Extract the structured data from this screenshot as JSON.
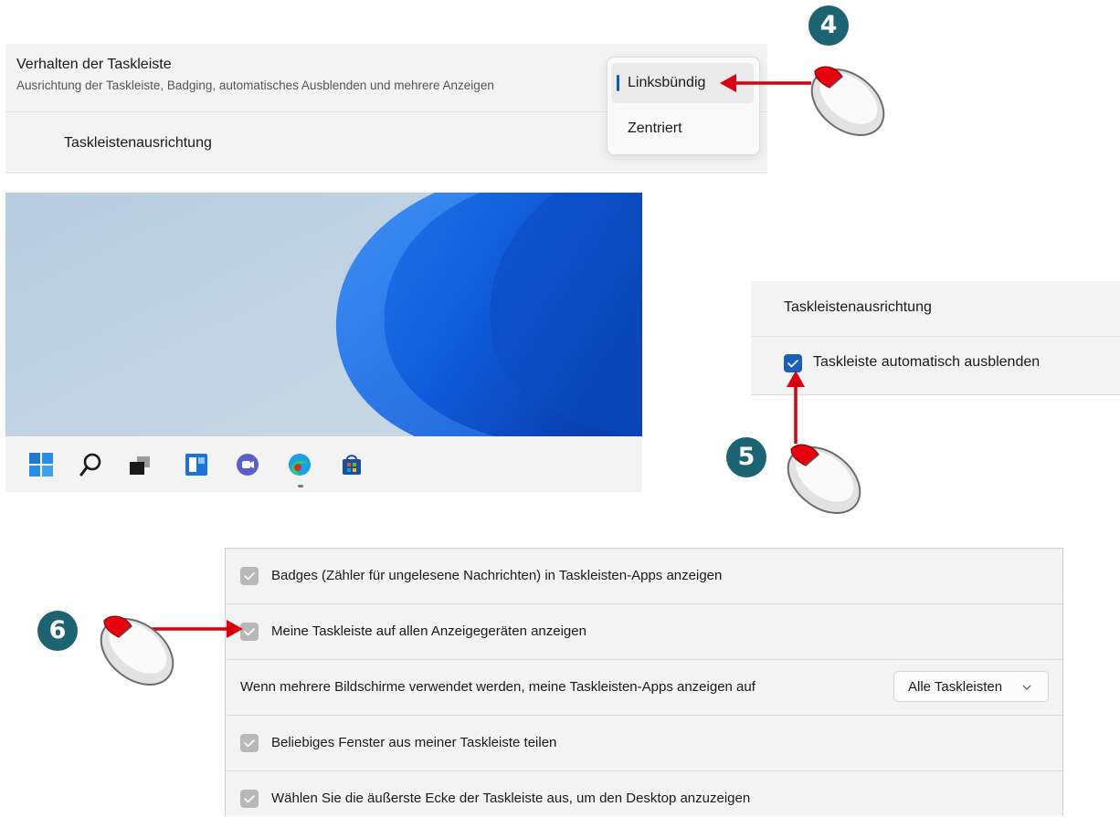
{
  "taskbar_settings": {
    "title": "Verhalten der Taskleiste",
    "subtitle": "Ausrichtung der Taskleiste, Badging, automatisches Ausblenden und mehrere Anzeigen",
    "alignment_label": "Taskleistenausrichtung"
  },
  "alignment_flyout": {
    "options": [
      {
        "label": "Linksbündig",
        "selected": true
      },
      {
        "label": "Zentriert",
        "selected": false
      }
    ]
  },
  "taskbar_icons": [
    "windows-start-icon",
    "search-icon",
    "task-view-icon",
    "widgets-icon",
    "chat-icon",
    "edge-icon",
    "store-icon"
  ],
  "autohide_panel": {
    "alignment_label": "Taskleistenausrichtung",
    "autohide_label": "Taskleiste automatisch ausblenden",
    "autohide_checked": true
  },
  "multi_display_panel": {
    "rows": [
      {
        "label": "Badges (Zähler für ungelesene Nachrichten) in Taskleisten-Apps anzeigen",
        "checked": true
      },
      {
        "label": "Meine Taskleiste auf allen Anzeigegeräten anzeigen",
        "checked": true
      },
      {
        "label": "Wenn mehrere Bildschirme verwendet werden, meine Taskleisten-Apps anzeigen auf",
        "dropdown_value": "Alle Taskleisten"
      },
      {
        "label": "Beliebiges Fenster aus meiner Taskleiste teilen",
        "checked": true
      },
      {
        "label": "Wählen Sie die äußerste Ecke der Taskleiste aus, um den Desktop anzuzeigen",
        "checked": true
      }
    ]
  },
  "callouts": [
    "4",
    "5",
    "6"
  ],
  "colors": {
    "accent": "#005fb8",
    "checkbox_blue": "#1a5fb4",
    "callout_badge": "#1d6472",
    "arrow": "#d9000d"
  }
}
